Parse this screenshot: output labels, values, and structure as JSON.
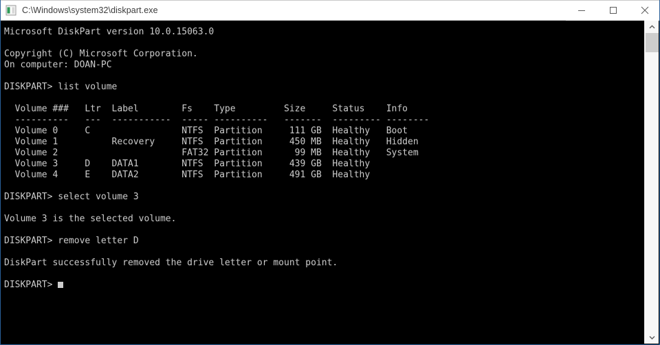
{
  "window": {
    "title": "C:\\Windows\\system32\\diskpart.exe",
    "icon": "console-icon",
    "border_color": "#2a6099",
    "titlebar_bg": "#ffffff",
    "console_bg": "#000000",
    "console_fg": "#cccccc",
    "controls": {
      "minimize_label": "Minimize",
      "maximize_label": "Maximize",
      "close_label": "Close"
    }
  },
  "scrollbar": {
    "up_arrow": "chevron-up-icon",
    "down_arrow": "chevron-down-icon",
    "thumb_color": "#cdcdcd",
    "track_color": "#f7f7f7"
  },
  "console": {
    "header": {
      "version_line": "Microsoft DiskPart version 10.0.15063.0",
      "copyright_line": "Copyright (C) Microsoft Corporation.",
      "computer_line": "On computer: DOAN-PC"
    },
    "prompt": "DISKPART>",
    "commands": {
      "list_volume": "list volume",
      "select_volume": "select volume 3",
      "remove_letter": "remove letter D"
    },
    "messages": {
      "selected_volume": "Volume 3 is the selected volume.",
      "removed_letter": "DiskPart successfully removed the drive letter or mount point."
    },
    "cursor": "block-cursor",
    "volume_table": {
      "headers": [
        "Volume ###",
        "Ltr",
        "Label",
        "Fs",
        "Type",
        "Size",
        "Status",
        "Info"
      ],
      "separator": [
        "----------",
        "---",
        "-----------",
        "-----",
        "----------",
        "-------",
        "---------",
        "--------"
      ],
      "rows": [
        {
          "volume": "Volume 0",
          "ltr": "C",
          "label": "",
          "fs": "NTFS",
          "type": "Partition",
          "size": "111 GB",
          "status": "Healthy",
          "info": "Boot"
        },
        {
          "volume": "Volume 1",
          "ltr": "",
          "label": "Recovery",
          "fs": "NTFS",
          "type": "Partition",
          "size": "450 MB",
          "status": "Healthy",
          "info": "Hidden"
        },
        {
          "volume": "Volume 2",
          "ltr": "",
          "label": "",
          "fs": "FAT32",
          "type": "Partition",
          "size": "99 MB",
          "status": "Healthy",
          "info": "System"
        },
        {
          "volume": "Volume 3",
          "ltr": "D",
          "label": "DATA1",
          "fs": "NTFS",
          "type": "Partition",
          "size": "439 GB",
          "status": "Healthy",
          "info": ""
        },
        {
          "volume": "Volume 4",
          "ltr": "E",
          "label": "DATA2",
          "fs": "NTFS",
          "type": "Partition",
          "size": "491 GB",
          "status": "Healthy",
          "info": ""
        }
      ]
    }
  }
}
